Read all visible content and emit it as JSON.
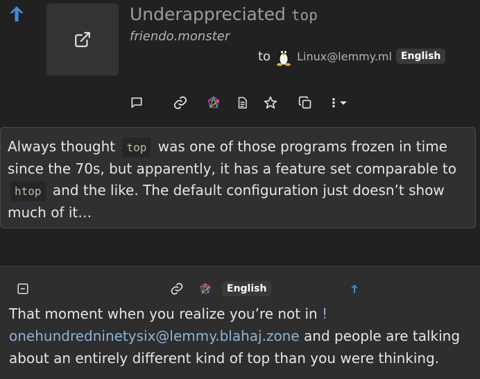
{
  "post": {
    "title": "Underappreciated",
    "title_code": "top",
    "domain": "friendo.monster",
    "to_label": "to",
    "community": "Linux@lemmy.ml",
    "language": "English",
    "body": {
      "t1": "Always thought",
      "code1": "top",
      "t2": "was one of those programs frozen in time since the 70s, but apparently, it has a feature set comparable to",
      "code2": "htop",
      "t3": "and the like. The default configuration just doesn’t show much of it…"
    }
  },
  "toolbar": {
    "icons": [
      "comment-icon",
      "link-icon",
      "fediverse-icon",
      "source-icon",
      "star-icon",
      "copy-icon",
      "more-icon",
      "caret-down-icon"
    ]
  },
  "comment": {
    "language": "English",
    "t1": "That moment when you realize you’re not in",
    "bang": "!",
    "link": "onehundredninetysix@lemmy.blahaj.zone",
    "t2": "and people are talking about an entirely different kind of top than you were thinking."
  },
  "colors": {
    "accent": "#3b8fd9",
    "background": "#212121",
    "card": "#303030"
  }
}
